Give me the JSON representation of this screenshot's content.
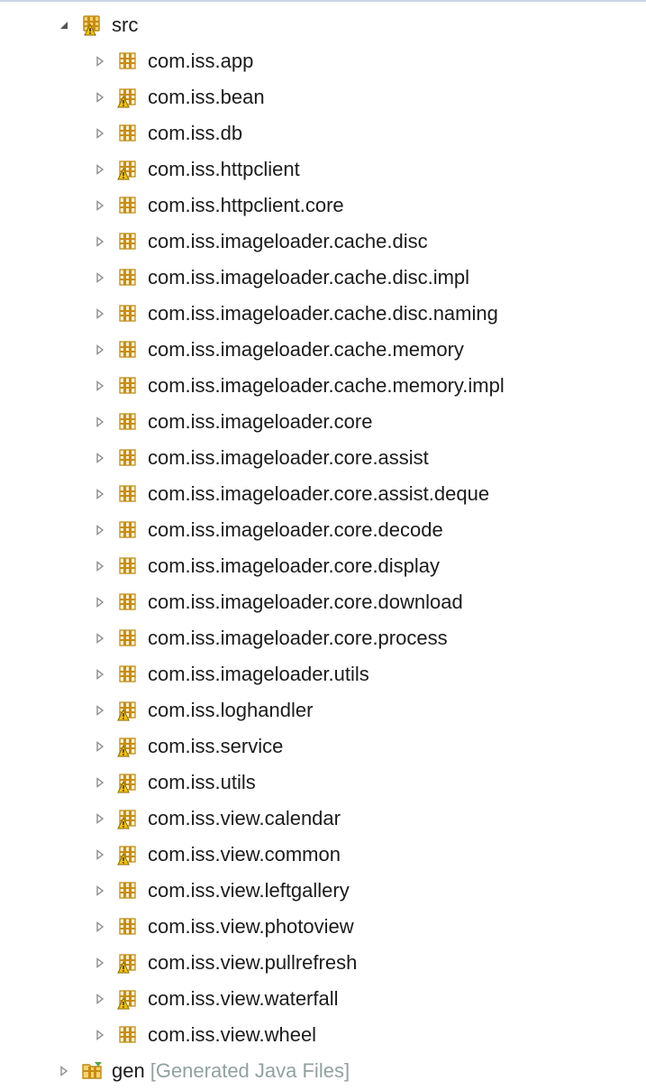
{
  "tree": {
    "root": {
      "label": "src",
      "expanded": true,
      "icon": "source-folder-warning-icon"
    },
    "packages": [
      {
        "label": "com.iss.app",
        "warning": false
      },
      {
        "label": "com.iss.bean",
        "warning": true
      },
      {
        "label": "com.iss.db",
        "warning": false
      },
      {
        "label": "com.iss.httpclient",
        "warning": true
      },
      {
        "label": "com.iss.httpclient.core",
        "warning": false
      },
      {
        "label": "com.iss.imageloader.cache.disc",
        "warning": false
      },
      {
        "label": "com.iss.imageloader.cache.disc.impl",
        "warning": false
      },
      {
        "label": "com.iss.imageloader.cache.disc.naming",
        "warning": false
      },
      {
        "label": "com.iss.imageloader.cache.memory",
        "warning": false
      },
      {
        "label": "com.iss.imageloader.cache.memory.impl",
        "warning": false
      },
      {
        "label": "com.iss.imageloader.core",
        "warning": false
      },
      {
        "label": "com.iss.imageloader.core.assist",
        "warning": false
      },
      {
        "label": "com.iss.imageloader.core.assist.deque",
        "warning": false
      },
      {
        "label": "com.iss.imageloader.core.decode",
        "warning": false
      },
      {
        "label": "com.iss.imageloader.core.display",
        "warning": false
      },
      {
        "label": "com.iss.imageloader.core.download",
        "warning": false
      },
      {
        "label": "com.iss.imageloader.core.process",
        "warning": false
      },
      {
        "label": "com.iss.imageloader.utils",
        "warning": false
      },
      {
        "label": "com.iss.loghandler",
        "warning": true
      },
      {
        "label": "com.iss.service",
        "warning": true
      },
      {
        "label": "com.iss.utils",
        "warning": true
      },
      {
        "label": "com.iss.view.calendar",
        "warning": true
      },
      {
        "label": "com.iss.view.common",
        "warning": true
      },
      {
        "label": "com.iss.view.leftgallery",
        "warning": false
      },
      {
        "label": "com.iss.view.photoview",
        "warning": false
      },
      {
        "label": "com.iss.view.pullrefresh",
        "warning": true
      },
      {
        "label": "com.iss.view.waterfall",
        "warning": true
      },
      {
        "label": "com.iss.view.wheel",
        "warning": false
      }
    ],
    "gen": {
      "label": "gen",
      "decoration": "[Generated Java Files]",
      "expanded": false,
      "icon": "generated-source-folder-icon"
    }
  },
  "colors": {
    "package_brown": "#c98c17",
    "package_dark": "#8a5a00",
    "warning_yellow": "#f3c400",
    "decoration_gray": "#93a0a0",
    "twisty_gray": "#8d8d8d"
  }
}
